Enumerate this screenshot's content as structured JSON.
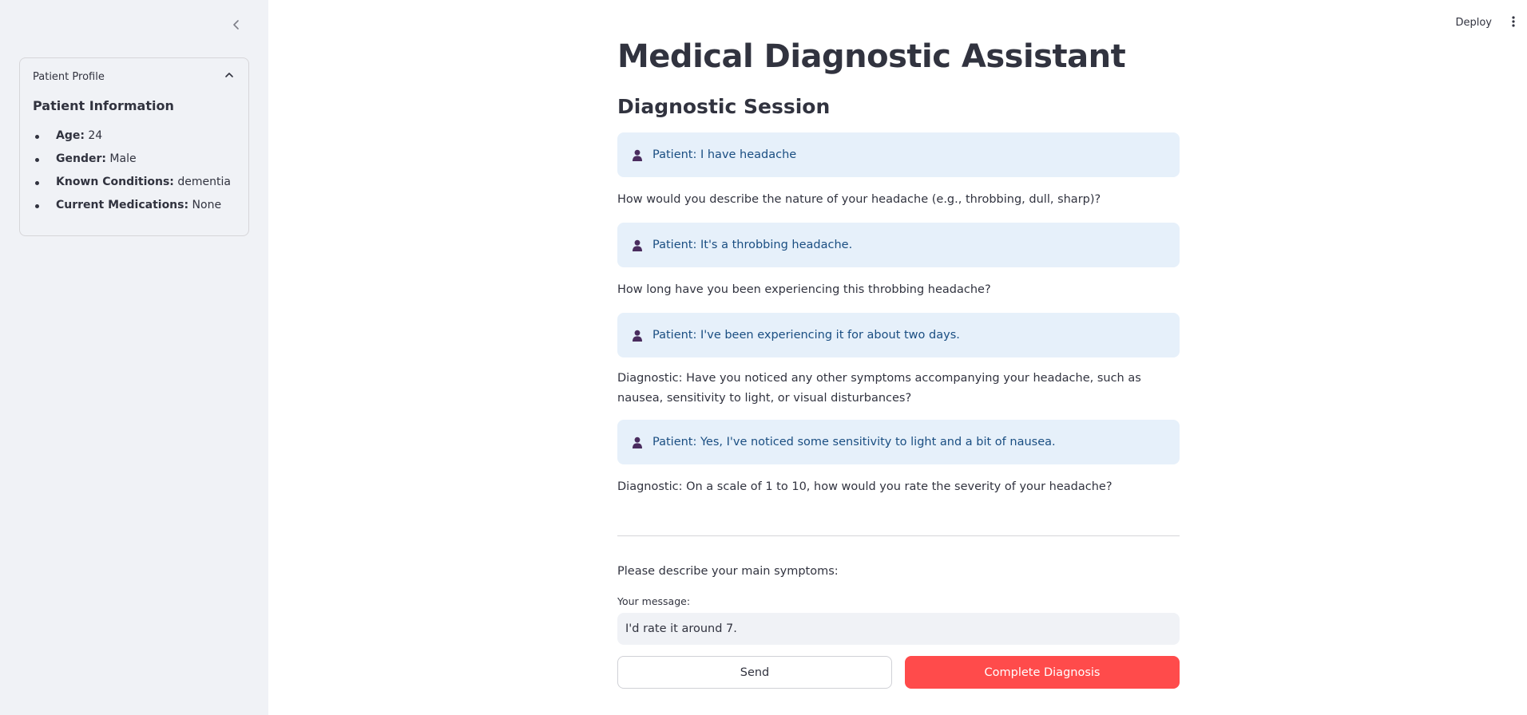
{
  "toolbar": {
    "deploy_label": "Deploy"
  },
  "sidebar": {
    "expander_title": "Patient Profile",
    "heading": "Patient Information",
    "info": [
      {
        "key": "Age:",
        "value": " 24"
      },
      {
        "key": "Gender:",
        "value": " Male"
      },
      {
        "key": "Known Conditions:",
        "value": " dementia"
      },
      {
        "key": "Current Medications:",
        "value": " None"
      }
    ]
  },
  "main": {
    "title": "Medical Diagnostic Assistant",
    "subtitle": "Diagnostic Session",
    "conversation": [
      {
        "role": "patient",
        "text": "Patient: I have headache"
      },
      {
        "role": "diagnostic",
        "text": "How would you describe the nature of your headache (e.g., throbbing, dull, sharp)?"
      },
      {
        "role": "patient",
        "text": "Patient: It's a throbbing headache."
      },
      {
        "role": "diagnostic",
        "text": "How long have you been experiencing this throbbing headache?"
      },
      {
        "role": "patient",
        "text": "Patient: I've been experiencing it for about two days."
      },
      {
        "role": "diagnostic",
        "text": "Diagnostic: Have you noticed any other symptoms accompanying your headache, such as nausea, sensitivity to light, or visual disturbances?"
      },
      {
        "role": "patient",
        "text": "Patient: Yes, I've noticed some sensitivity to light and a bit of nausea."
      },
      {
        "role": "diagnostic",
        "text": "Diagnostic: On a scale of 1 to 10, how would you rate the severity of your headache?"
      }
    ],
    "prompt": "Please describe your main symptoms:",
    "input_label": "Your message:",
    "input_value": "I'd rate it around 7.",
    "send_label": "Send",
    "complete_label": "Complete Diagnosis"
  },
  "colors": {
    "sidebar_bg": "#f0f2f6",
    "patient_bubble_bg": "#e6f0fa",
    "patient_text": "#1a4e82",
    "primary_button": "#ff4b4b",
    "text": "#31333f"
  },
  "icons": [
    "chevron-left-icon",
    "chevron-up-icon",
    "kebab-menu-icon",
    "user-icon"
  ]
}
